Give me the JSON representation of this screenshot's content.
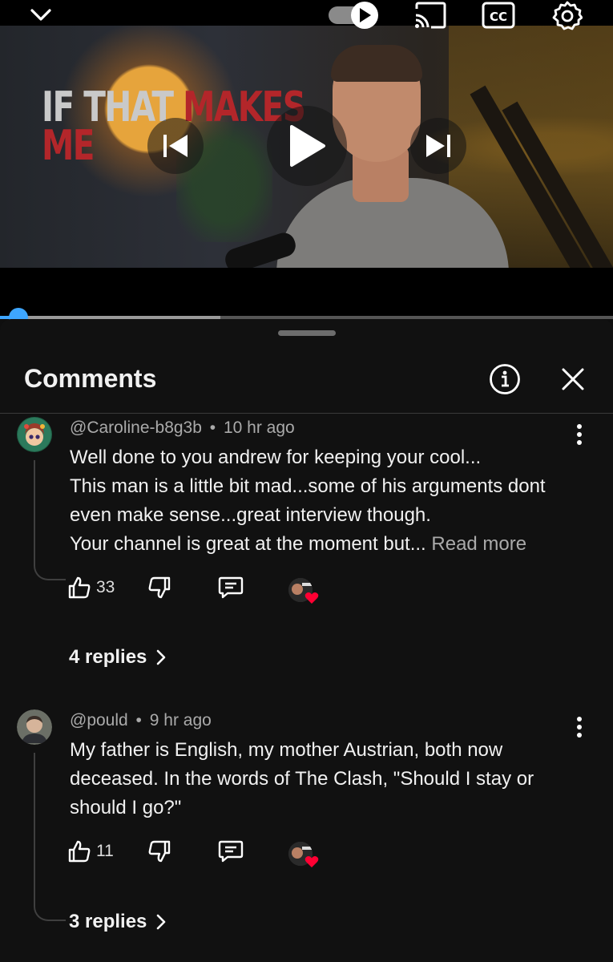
{
  "player": {
    "thumbnail_text_white": "IF THAT ",
    "thumbnail_text_red_1": "MAKES",
    "thumbnail_text_red_2": "ME",
    "progress_fraction": 0.03,
    "buffer_fraction": 0.36,
    "icons": [
      "chevron-down-icon",
      "autoplay-toggle-icon",
      "cast-icon",
      "closed-captions-icon",
      "settings-gear-icon",
      "previous-icon",
      "play-icon",
      "next-icon"
    ],
    "accent_color": "#3ea6ff"
  },
  "panel": {
    "title": "Comments",
    "icons": [
      "info-icon",
      "close-icon"
    ]
  },
  "comments": [
    {
      "author": "@Caroline-b8g3b",
      "separator": "•",
      "time": "10 hr ago",
      "text": "Well done to you andrew for keeping your cool...\nThis man is a little bit mad...some of his arguments dont even make sense...great interview though.\nYour channel is great at the moment but... ",
      "read_more": "Read more",
      "likes": "33",
      "replies": "4 replies"
    },
    {
      "author": "@pould",
      "separator": "•",
      "time": "9 hr ago",
      "text": "My father is English, my mother Austrian, both now deceased. In the words of The Clash, \"Should I stay or should I go?\"",
      "read_more": "",
      "likes": "11",
      "replies": "3 replies"
    }
  ]
}
